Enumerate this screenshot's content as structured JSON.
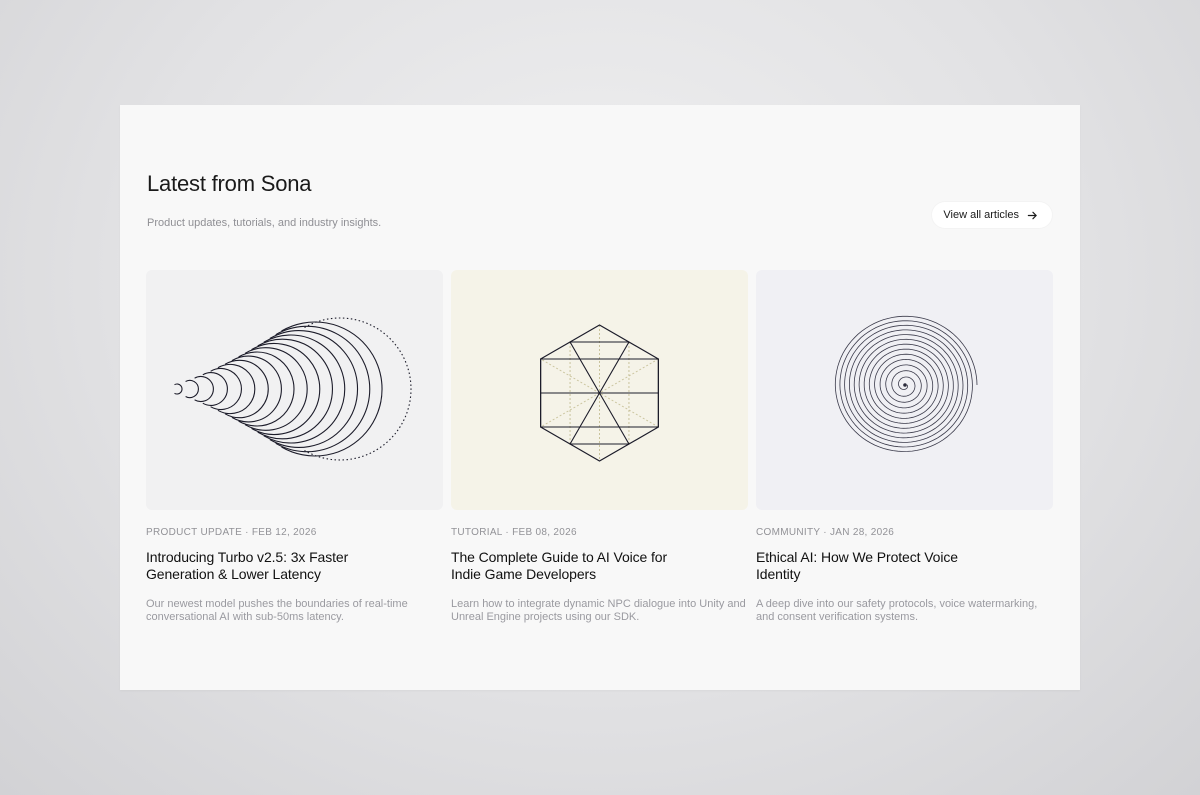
{
  "section": {
    "heading": "Latest from Sona",
    "subheading": "Product updates, tutorials, and industry insights.",
    "view_all_label": "View all articles"
  },
  "colors": {
    "thumb_1_bg": "#f1f1f2",
    "thumb_2_bg": "#f5f3e8",
    "thumb_3_bg": "#f0f0f4",
    "ink": "#1c1c2a",
    "accent_dotted": "#c9c39c"
  },
  "articles": [
    {
      "category_date": "PRODUCT UPDATE · FEB 12, 2026",
      "title": "Introducing Turbo v2.5: 3x Faster Generation & Lower Latency",
      "description": "Our newest model pushes the boundaries of real-time conversational AI with sub-50ms latency.",
      "thumbnail_icon": "concentric-arcs-illustration"
    },
    {
      "category_date": "TUTORIAL · FEB 08, 2026",
      "title": "The Complete Guide to AI Voice for Indie Game Developers",
      "description": "Learn how to integrate dynamic NPC dialogue into Unity and Unreal Engine projects using our SDK.",
      "thumbnail_icon": "hexagon-grid-illustration"
    },
    {
      "category_date": "COMMUNITY · JAN 28, 2026",
      "title": "Ethical AI: How We Protect Voice Identity",
      "description": "A deep dive into our safety protocols, voice watermarking, and consent verification systems.",
      "thumbnail_icon": "spiral-illustration"
    }
  ]
}
